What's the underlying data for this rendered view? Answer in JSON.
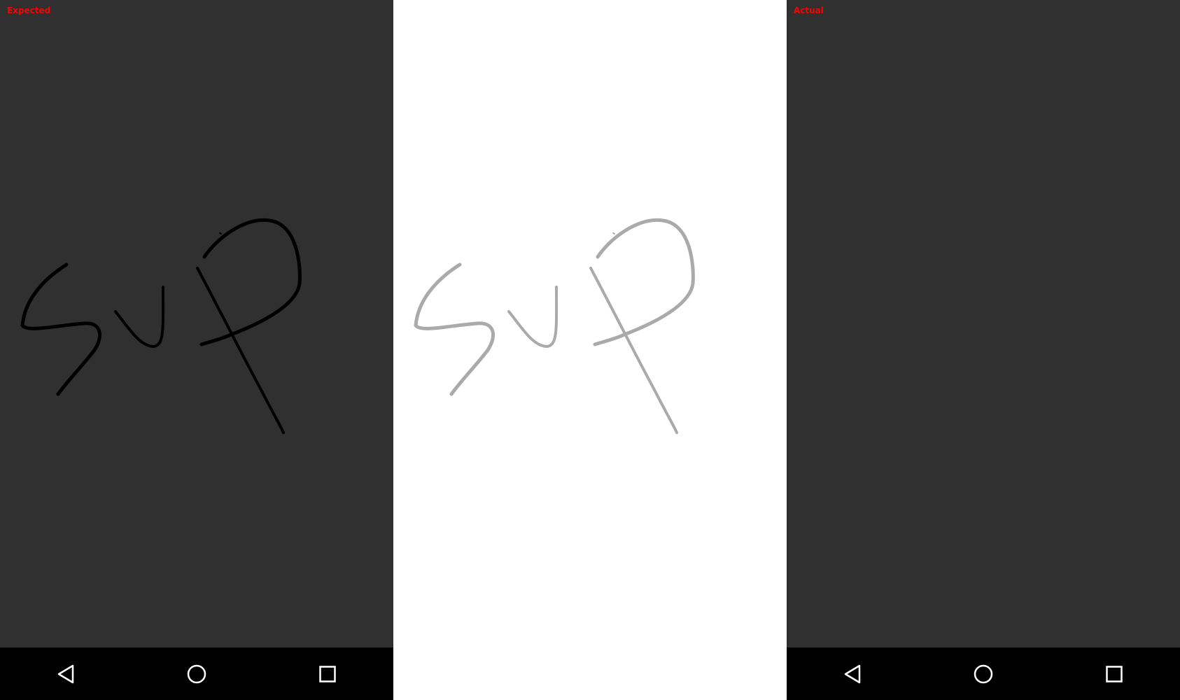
{
  "labels": {
    "expected": "Expected",
    "actual": "Actual"
  },
  "colors": {
    "panel_background": "#303030",
    "diff_background": "#ffffff",
    "label_text": "#ff0000",
    "expected_stroke": "#000000",
    "diff_stroke": "#aaaaaa",
    "navbar_background": "#000000",
    "nav_icon": "#ffffff"
  },
  "navbar": {
    "buttons": [
      {
        "icon": "back-triangle-icon"
      },
      {
        "icon": "home-circle-icon"
      },
      {
        "icon": "recents-square-icon"
      }
    ]
  }
}
